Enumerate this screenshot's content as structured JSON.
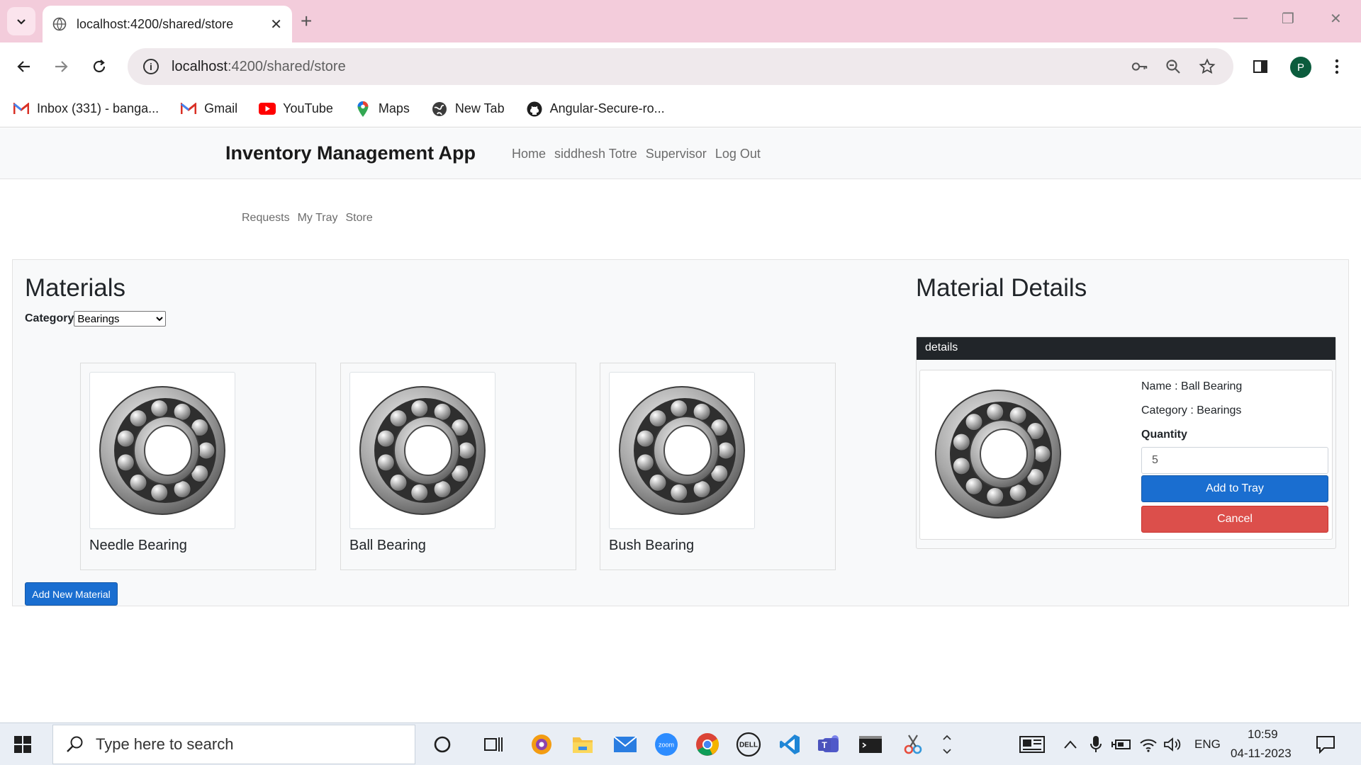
{
  "browser": {
    "tab_title": "localhost:4200/shared/store",
    "url_host": "localhost",
    "url_path": ":4200/shared/store",
    "profile_initial": "P",
    "bookmarks": [
      {
        "label": "Inbox (331) - banga...",
        "icon": "gmail-icon"
      },
      {
        "label": "Gmail",
        "icon": "gmail-icon"
      },
      {
        "label": "YouTube",
        "icon": "youtube-icon"
      },
      {
        "label": "Maps",
        "icon": "maps-icon"
      },
      {
        "label": "New Tab",
        "icon": "globe-icon"
      },
      {
        "label": "Angular-Secure-ro...",
        "icon": "github-icon"
      }
    ]
  },
  "app": {
    "brand": "Inventory Management App",
    "nav": [
      "Home",
      "siddhesh Totre",
      "Supervisor",
      "Log Out"
    ],
    "subnav": [
      "Requests",
      "My Tray",
      "Store"
    ]
  },
  "materials": {
    "title": "Materials",
    "category_label": "Category",
    "category_selected": "Bearings",
    "items": [
      {
        "name": "Needle Bearing"
      },
      {
        "name": "Ball Bearing"
      },
      {
        "name": "Bush Bearing"
      }
    ],
    "add_button": "Add New Material"
  },
  "details": {
    "title": "Material Details",
    "header": "details",
    "name_line": "Name : Ball Bearing",
    "category_line": "Category : Bearings",
    "quantity_label": "Quantity",
    "quantity_value": "5",
    "add_to_tray": "Add to Tray",
    "cancel": "Cancel"
  },
  "taskbar": {
    "search_placeholder": "Type here to search",
    "language": "ENG",
    "time": "10:59",
    "date": "04-11-2023"
  },
  "colors": {
    "tabstrip": "#f3ccdb",
    "primary_button": "#1a6ed0",
    "danger_button": "#dc4f4b",
    "details_header": "#212529"
  }
}
